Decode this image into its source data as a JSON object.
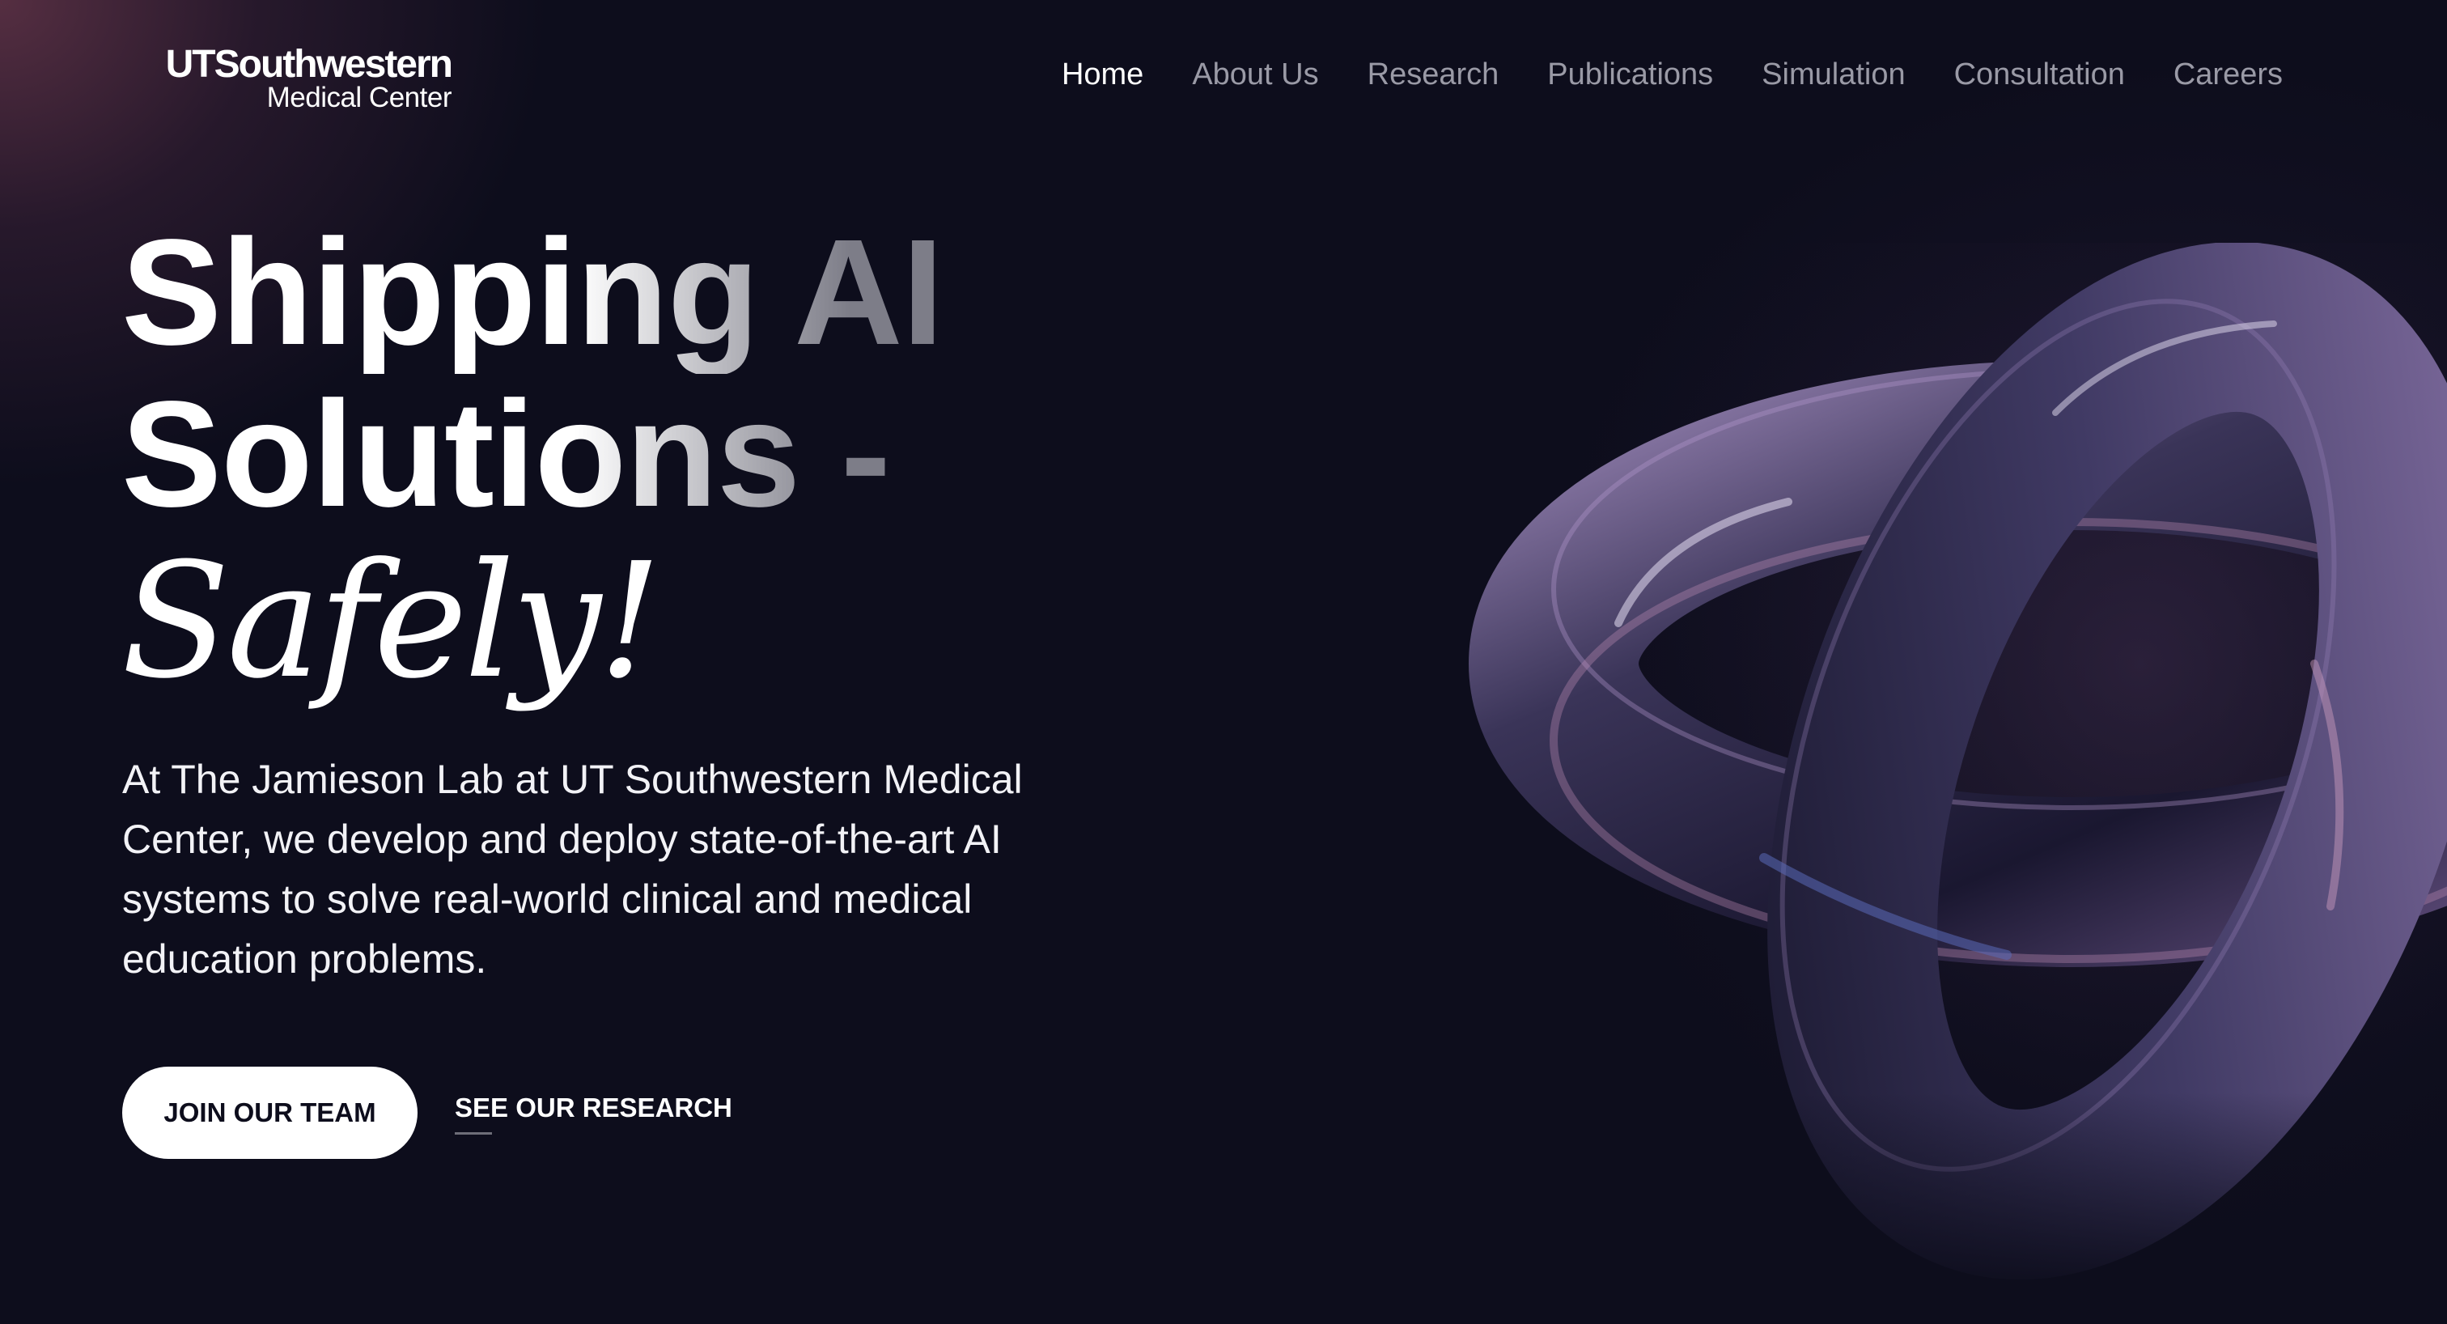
{
  "header": {
    "logo_top": "UTSouthwestern",
    "logo_bottom": "Medical Center",
    "nav": [
      {
        "label": "Home",
        "active": true
      },
      {
        "label": "About Us",
        "active": false
      },
      {
        "label": "Research",
        "active": false
      },
      {
        "label": "Publications",
        "active": false
      },
      {
        "label": "Simulation",
        "active": false
      },
      {
        "label": "Consultation",
        "active": false
      },
      {
        "label": "Careers",
        "active": false
      }
    ]
  },
  "hero": {
    "headline_line1": "Shipping AI",
    "headline_line2": "Solutions -",
    "headline_italic": "Safely!",
    "lede": "At The Jamieson Lab at UT Southwestern Medical Center, we develop and deploy state-of-the-art AI systems to solve real-world clinical and medical education problems.",
    "primary_cta": "JOIN OUR TEAM",
    "secondary_cta": "SEE OUR RESEARCH"
  },
  "colors": {
    "background": "#0d0d1c",
    "nav_inactive": "#9a9aa6",
    "nav_active": "#ffffff",
    "button_bg": "#ffffff",
    "button_text": "#0d0d1c",
    "knot_tube": "#2e2a4a",
    "knot_rim": "#8a6fa8"
  },
  "decorative": {
    "hero_art": "glossy-knot-illustration"
  }
}
